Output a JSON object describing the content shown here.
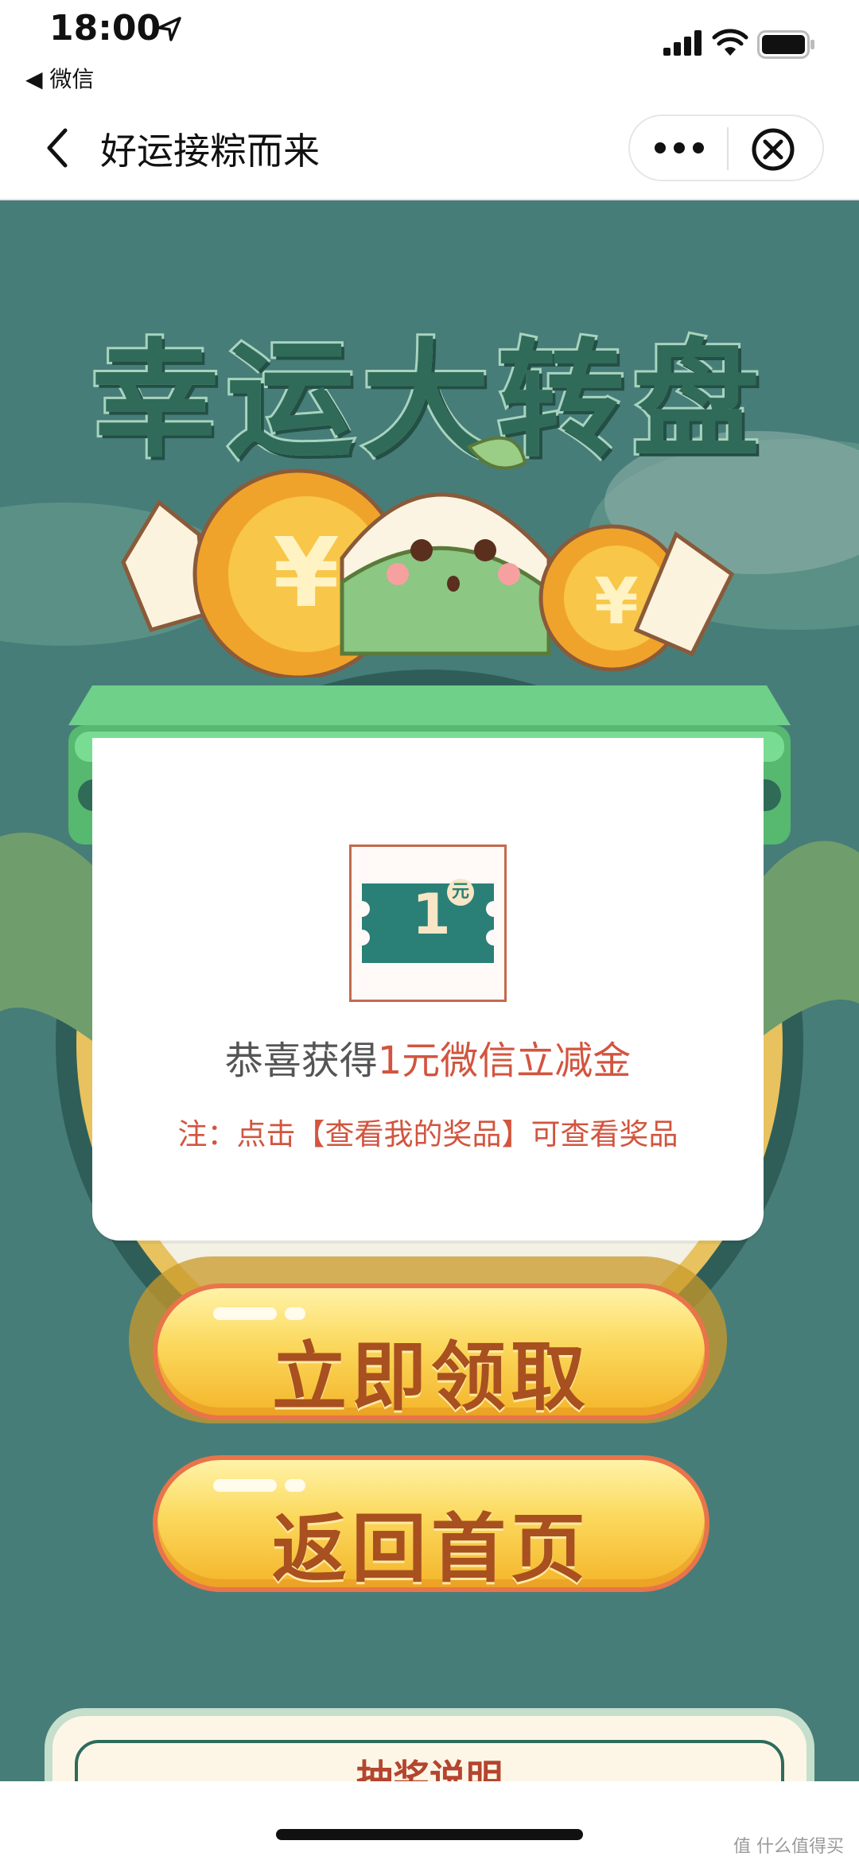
{
  "status_bar": {
    "time": "18:00",
    "back_app": "◀ 微信"
  },
  "nav": {
    "title": "好运接粽而来"
  },
  "banner": {
    "title": "幸运大转盘"
  },
  "modal": {
    "ticket_value": "1",
    "ticket_unit": "元",
    "congrats_prefix": "恭喜获得",
    "congrats_prize": "1元微信立减金",
    "note": "注：点击【查看我的奖品】可查看奖品"
  },
  "buttons": {
    "claim": "立即领取",
    "home": "返回首页"
  },
  "rules": {
    "title": "抽奖说明"
  },
  "watermark": "值 什么值得买",
  "colors": {
    "background": "#477d78",
    "accent": "#d2553f",
    "button": "#fbd85c",
    "ticket": "#2a8076"
  }
}
